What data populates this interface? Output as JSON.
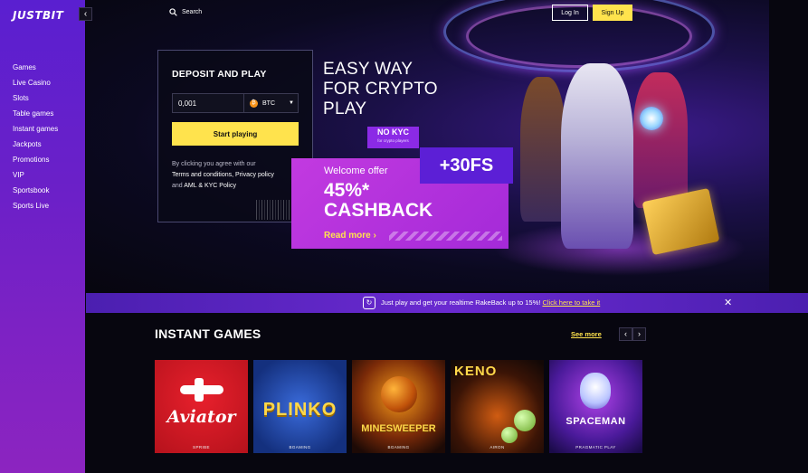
{
  "brand": {
    "logo": "JUSTBIT",
    "collapse_icon": "‹"
  },
  "sidebar": {
    "items": [
      {
        "label": "Games"
      },
      {
        "label": "Live Casino"
      },
      {
        "label": "Slots"
      },
      {
        "label": "Table games"
      },
      {
        "label": "Instant games"
      },
      {
        "label": "Jackpots"
      },
      {
        "label": "Promotions"
      },
      {
        "label": "VIP"
      },
      {
        "label": "Sportsbook"
      },
      {
        "label": "Sports Live"
      }
    ]
  },
  "header": {
    "search_label": "Search",
    "login_label": "Log In",
    "signup_label": "Sign Up"
  },
  "deposit": {
    "title": "DEPOSIT AND PLAY",
    "amount": "0,001",
    "currency": "BTC",
    "currency_icon": "₿",
    "start_label": "Start playing",
    "terms_prefix": "By clicking you agree with our",
    "terms_link1": "Terms and conditions,",
    "terms_link2": "Privacy policy",
    "terms_and": "and",
    "terms_link3": "AML & KYC Policy"
  },
  "hero": {
    "headline_1": "EASY WAY",
    "headline_2": "FOR CRYPTO",
    "headline_3": "PLAY",
    "nokyc_title": "NO KYC",
    "nokyc_sub": "for crypto players",
    "offer_label": "Welcome offer",
    "offer_pct": "45%*",
    "offer_cb": "CASHBACK",
    "read_more": "Read more ›",
    "fs": "+30FS"
  },
  "rakeback": {
    "text": "Just play and get your realtime RakeBack up to 15%!",
    "link": "Click here to take it",
    "close": "✕"
  },
  "instant_games": {
    "title": "INSTANT GAMES",
    "see_more": "See more",
    "prev": "‹",
    "next": "›",
    "tiles": [
      {
        "name": "Aviator",
        "studio": "SPRIBE"
      },
      {
        "name": "PLINKO",
        "studio": "BGAMING"
      },
      {
        "name": "MINESWEEPER",
        "studio": "BGAMING"
      },
      {
        "name": "KENO",
        "studio": "AIRON"
      },
      {
        "name": "SPACEMAN",
        "studio": "PRAGMATIC PLAY"
      }
    ]
  },
  "colors": {
    "accent": "#ffe34d",
    "sidebar": "#6b20c8",
    "offer": "#c23ae0",
    "fs": "#5c1fd6"
  }
}
